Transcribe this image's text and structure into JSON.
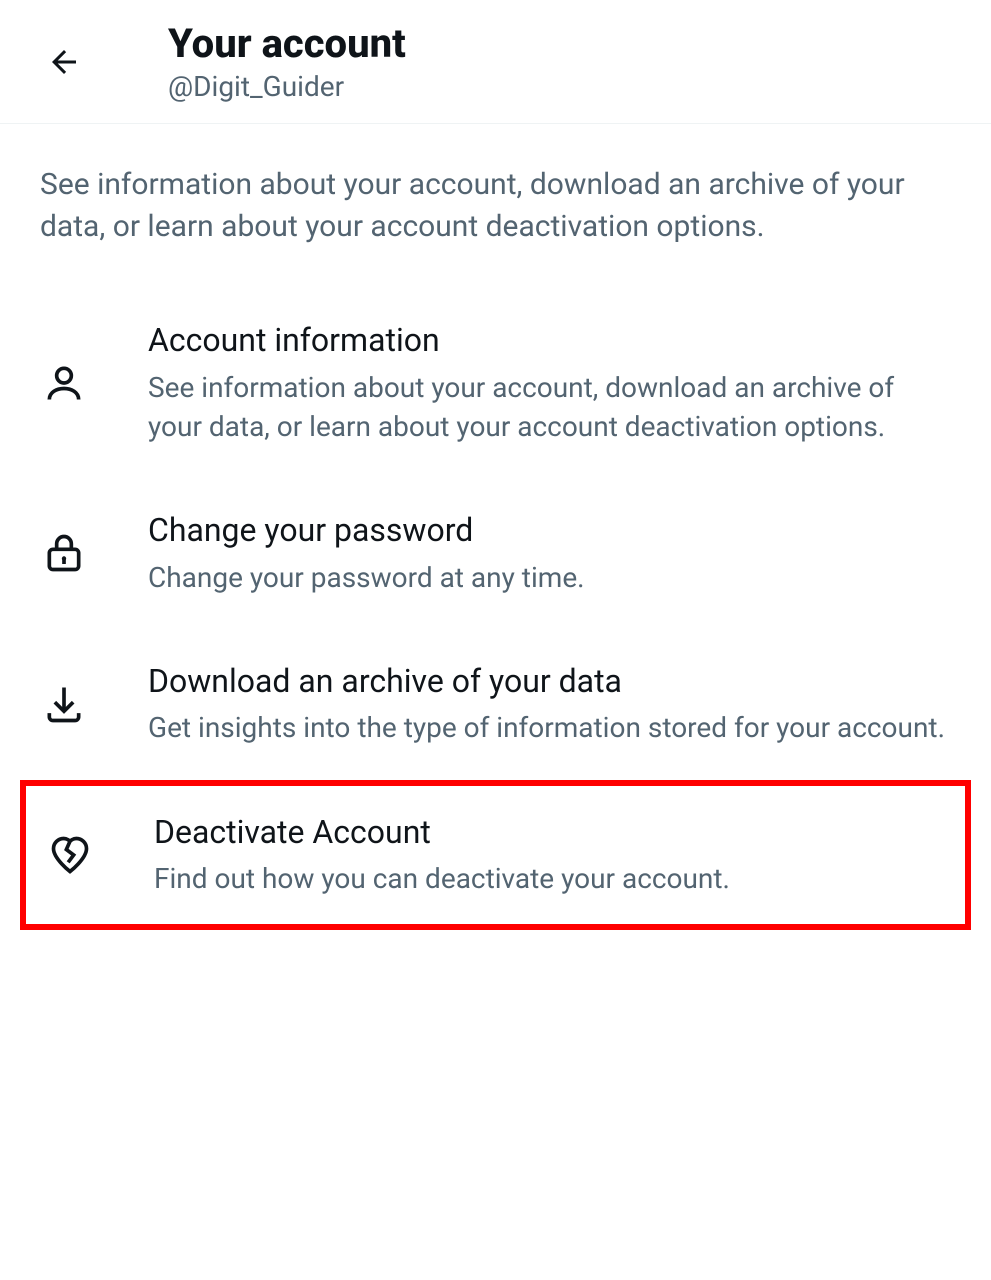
{
  "header": {
    "title": "Your account",
    "handle": "@Digit_Guider"
  },
  "description": "See information about your account, download an archive of your data, or learn about your account deactivation options.",
  "menu": [
    {
      "title": "Account information",
      "subtitle": "See information about your account, download an archive of your data, or learn about your account deactivation options."
    },
    {
      "title": "Change your password",
      "subtitle": "Change your password at any time."
    },
    {
      "title": "Download an archive of your data",
      "subtitle": "Get insights into the type of information stored for your account."
    },
    {
      "title": "Deactivate Account",
      "subtitle": "Find out how you can deactivate your account."
    }
  ]
}
